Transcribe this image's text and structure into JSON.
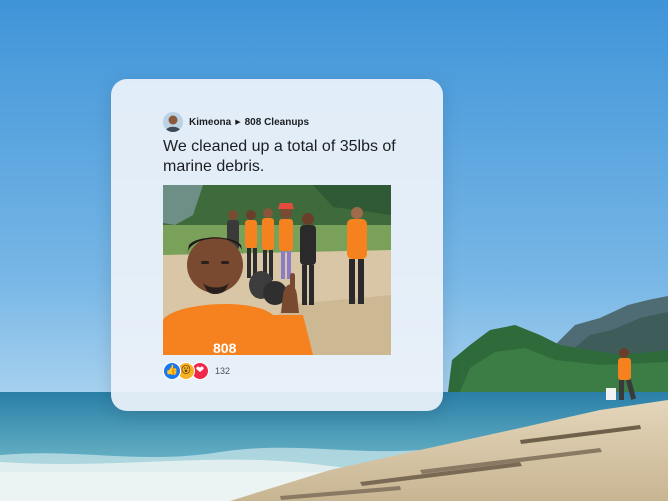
{
  "post": {
    "author": "Kimeona",
    "group": "808 Cleanups",
    "text": "We cleaned up a total of 35lbs of marine debris.",
    "reactions": {
      "types": [
        "like-icon",
        "wow-icon",
        "love-icon"
      ],
      "count": "132"
    },
    "shirt_print": "808"
  },
  "colors": {
    "sky": "#4e9edc",
    "ocean": "#2f8fb0",
    "sand": "#d8c7a8",
    "shirt_orange": "#f5821f",
    "like_blue": "#1877f2",
    "love_red": "#f02849",
    "wow_yellow": "#f7b125"
  }
}
